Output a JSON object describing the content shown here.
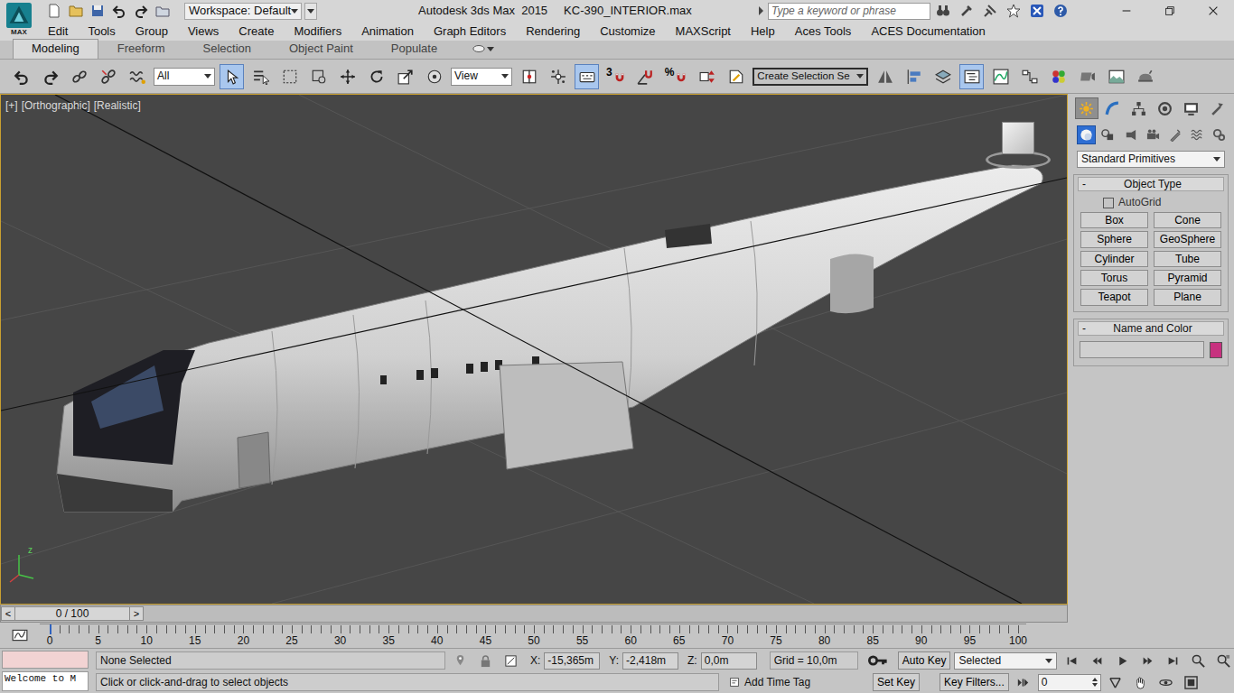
{
  "window": {
    "logo": "MAX",
    "workspace": "Workspace: Default",
    "title": "Autodesk 3ds Max  2015",
    "file": "KC-390_INTERIOR.max"
  },
  "quick_access": [
    {
      "kind": "new"
    },
    {
      "kind": "open"
    },
    {
      "kind": "save"
    },
    {
      "kind": "undo"
    },
    {
      "kind": "redo"
    },
    {
      "kind": "project"
    }
  ],
  "search": {
    "placeholder": "Type a keyword or phrase"
  },
  "infocenter": [
    {
      "kind": "binoculars"
    },
    {
      "kind": "tools"
    },
    {
      "kind": "satellite"
    },
    {
      "kind": "star"
    },
    {
      "kind": "exchange"
    },
    {
      "kind": "help"
    }
  ],
  "menu": [
    "Edit",
    "Tools",
    "Group",
    "Views",
    "Create",
    "Modifiers",
    "Animation",
    "Graph Editors",
    "Rendering",
    "Customize",
    "MAXScript",
    "Help",
    "Aces Tools",
    "ACES Documentation"
  ],
  "ribbon_tabs": [
    {
      "label": "Modeling",
      "selected": true
    },
    {
      "label": "Freeform",
      "selected": false
    },
    {
      "label": "Selection",
      "selected": false
    },
    {
      "label": "Object Paint",
      "selected": false
    },
    {
      "label": "Populate",
      "selected": false
    }
  ],
  "toolbar": [
    {
      "kind": "undo",
      "active": false
    },
    {
      "kind": "redo",
      "active": false
    },
    {
      "kind": "link",
      "active": false
    },
    {
      "kind": "unlink",
      "active": false
    },
    {
      "kind": "bind",
      "active": false
    },
    {
      "kind": "dropdown",
      "label": "All"
    },
    {
      "kind": "select",
      "active": true
    },
    {
      "kind": "selname",
      "active": false
    },
    {
      "kind": "rect",
      "active": false
    },
    {
      "kind": "crossing",
      "active": false
    },
    {
      "kind": "move",
      "active": false
    },
    {
      "kind": "rotate",
      "active": false
    },
    {
      "kind": "scale",
      "active": false
    },
    {
      "kind": "place",
      "active": false
    },
    {
      "kind": "dropdown",
      "label": "View"
    },
    {
      "kind": "pivot",
      "active": false
    },
    {
      "kind": "manipulate",
      "active": false
    },
    {
      "kind": "shortcut",
      "active": true
    },
    {
      "kind": "snap",
      "label": "3",
      "active": false
    },
    {
      "kind": "anglesnap",
      "active": false
    },
    {
      "kind": "snap",
      "label": "%",
      "active": false
    },
    {
      "kind": "spinnersnap",
      "active": false
    },
    {
      "kind": "namedsel",
      "active": false
    },
    {
      "kind": "field",
      "label": "Create Selection Se"
    },
    {
      "kind": "mirror",
      "active": false
    },
    {
      "kind": "align",
      "active": false
    },
    {
      "kind": "layers",
      "active": false
    },
    {
      "kind": "explorer",
      "active": true
    },
    {
      "kind": "curve",
      "active": false
    },
    {
      "kind": "schematic",
      "active": false
    },
    {
      "kind": "material",
      "active": false
    },
    {
      "kind": "rendersetup",
      "active": false
    },
    {
      "kind": "framewin",
      "active": false
    },
    {
      "kind": "render",
      "active": false
    }
  ],
  "viewport": {
    "labels": [
      "[+]",
      "[Orthographic]",
      "[Realistic]"
    ],
    "active": true,
    "axis_label": "z"
  },
  "command_panel": {
    "tabs": [
      {
        "kind": "create",
        "selected": true
      },
      {
        "kind": "modify",
        "selected": false
      },
      {
        "kind": "hierarchy",
        "selected": false
      },
      {
        "kind": "motion",
        "selected": false
      },
      {
        "kind": "display",
        "selected": false
      },
      {
        "kind": "utilities",
        "selected": false
      }
    ],
    "categories": [
      {
        "kind": "geometry",
        "selected": true
      },
      {
        "kind": "shapes",
        "selected": false
      },
      {
        "kind": "lights",
        "selected": false
      },
      {
        "kind": "cameras",
        "selected": false
      },
      {
        "kind": "helpers",
        "selected": false
      },
      {
        "kind": "spacewarps",
        "selected": false
      },
      {
        "kind": "systems",
        "selected": false
      }
    ],
    "type": "Standard Primitives",
    "object_type": {
      "toggle": "-",
      "title": "Object Type",
      "autogrid": {
        "label": "AutoGrid",
        "checked": false
      },
      "buttons": [
        "Box",
        "Cone",
        "Sphere",
        "GeoSphere",
        "Cylinder",
        "Tube",
        "Torus",
        "Pyramid",
        "Teapot",
        "Plane"
      ]
    },
    "name_color": {
      "toggle": "-",
      "title": "Name and Color",
      "color": "#c7317f"
    }
  },
  "time_slider": {
    "prev": "<",
    "label": "0 / 100",
    "next": ">",
    "level": 0
  },
  "track_bar": {
    "ticks": [
      "0",
      "5",
      "10",
      "15",
      "20",
      "25",
      "30",
      "35",
      "40",
      "45",
      "50",
      "55",
      "60",
      "65",
      "70",
      "75",
      "80",
      "85",
      "90",
      "95",
      "100"
    ]
  },
  "status": {
    "listener_output": "Welcome to M",
    "selection": "None Selected",
    "prompt": "Click or click-and-drag to select objects",
    "tools": [
      {
        "kind": "pin"
      },
      {
        "kind": "lock"
      },
      {
        "kind": "absolute"
      }
    ],
    "coords": [
      {
        "axis": "X:",
        "value": "-15,365m"
      },
      {
        "axis": "Y:",
        "value": "-2,418m"
      },
      {
        "axis": "Z:",
        "value": "0,0m"
      }
    ],
    "grid": "Grid = 10,0m",
    "time_tag": "Add Time Tag",
    "auto_key": {
      "label": "Auto Key",
      "on": false
    },
    "key_filter_mode": "Selected",
    "set_key": "Set Key",
    "key_filters": "Key Filters...",
    "frame": "0",
    "playback": [
      {
        "kind": "start"
      },
      {
        "kind": "prevkey"
      },
      {
        "kind": "play"
      },
      {
        "kind": "nextkey"
      },
      {
        "kind": "end"
      }
    ],
    "nav_top": [
      {
        "kind": "zoom"
      },
      {
        "kind": "zoomall"
      },
      {
        "kind": "extents"
      },
      {
        "kind": "extentsall"
      }
    ],
    "nav_bottom": [
      {
        "kind": "fov"
      },
      {
        "kind": "pan"
      },
      {
        "kind": "orbit"
      },
      {
        "kind": "maximize"
      }
    ]
  }
}
